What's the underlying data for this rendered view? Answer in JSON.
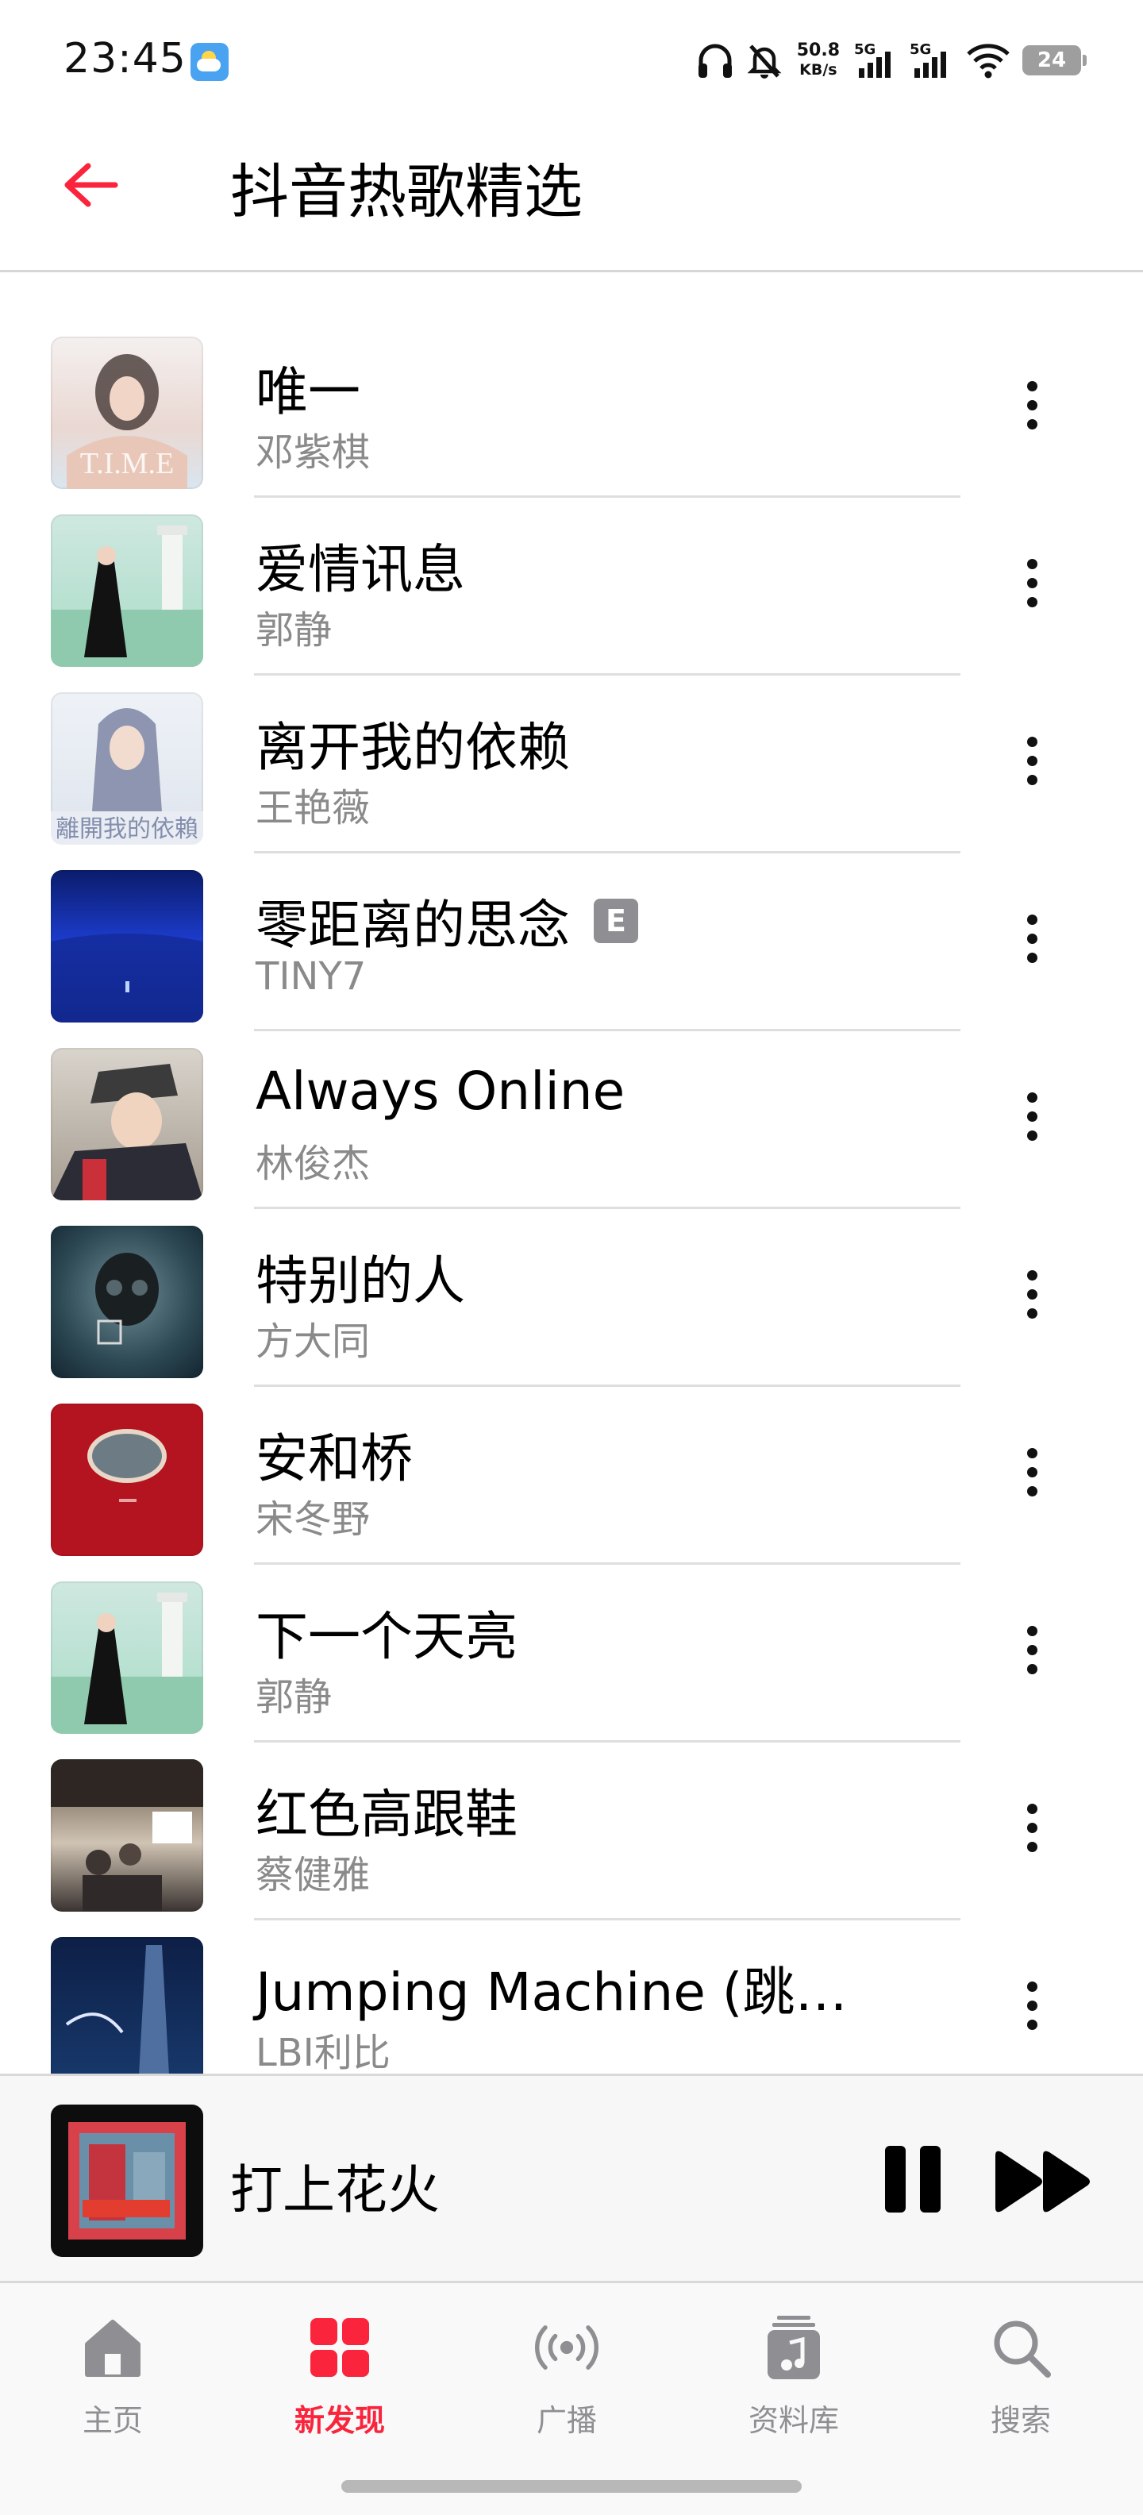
{
  "status_bar": {
    "time": "23:45",
    "net_speed_value": "50.8",
    "net_speed_unit": "KB/s",
    "signal1_label": "5G",
    "signal2_label": "5G",
    "battery": "24"
  },
  "header": {
    "title": "抖音热歌精选"
  },
  "songs": [
    {
      "title": "唯一",
      "artist": "邓紫棋",
      "explicit": false
    },
    {
      "title": "爱情讯息",
      "artist": "郭静",
      "explicit": false
    },
    {
      "title": "离开我的依赖",
      "artist": "王艳薇",
      "explicit": false
    },
    {
      "title": "零距离的思念",
      "artist": "TINY7",
      "explicit": true,
      "badge": "E"
    },
    {
      "title": "Always Online",
      "artist": "林俊杰",
      "explicit": false
    },
    {
      "title": "特别的人",
      "artist": "方大同",
      "explicit": false
    },
    {
      "title": "安和桥",
      "artist": "宋冬野",
      "explicit": false
    },
    {
      "title": "下一个天亮",
      "artist": "郭静",
      "explicit": false
    },
    {
      "title": "红色高跟鞋",
      "artist": "蔡健雅",
      "explicit": false
    },
    {
      "title": "Jumping Machine (跳…",
      "artist": "LBI利比",
      "explicit": false
    }
  ],
  "now_playing": {
    "title": "打上花火"
  },
  "tabs": [
    {
      "label": "主页",
      "icon": "home-icon",
      "active": false
    },
    {
      "label": "新发现",
      "icon": "grid-icon",
      "active": true
    },
    {
      "label": "广播",
      "icon": "radio-icon",
      "active": false
    },
    {
      "label": "资料库",
      "icon": "library-icon",
      "active": false
    },
    {
      "label": "搜索",
      "icon": "search-icon",
      "active": false
    }
  ],
  "colors": {
    "accent": "#fa243c",
    "secondary_text": "#8a8a8a",
    "tab_inactive": "#8e8e93"
  }
}
